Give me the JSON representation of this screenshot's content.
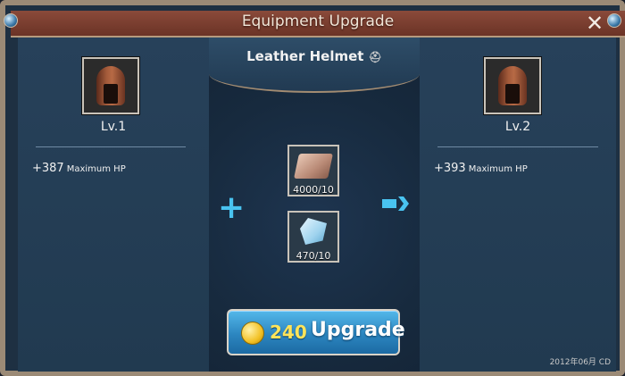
{
  "window": {
    "title": "Equipment Upgrade",
    "close_icon": "close-icon"
  },
  "item": {
    "name": "Leather Helmet",
    "name_icon": "helmet-small-icon"
  },
  "current": {
    "level": "Lv.1",
    "stat_value": "+387",
    "stat_name": "Maximum HP",
    "icon": "leather-helmet-icon"
  },
  "next": {
    "level": "Lv.2",
    "stat_value": "+393",
    "stat_name": "Maximum HP",
    "icon": "leather-helmet-icon"
  },
  "materials": [
    {
      "icon": "copper-ingot-icon",
      "qty": "4000/10"
    },
    {
      "icon": "crystal-shard-icon",
      "qty": "470/10"
    }
  ],
  "plus_icon": "plus-icon",
  "arrow_icon": "arrow-right-icon",
  "upgrade": {
    "coin_icon": "gold-coin-icon",
    "cost": "240",
    "label": "Upgrade"
  },
  "watermark": "2012年06月 CD",
  "colors": {
    "accent": "#49c3f0",
    "button": "#2c86c0",
    "cost": "#ffe45a",
    "titlebar": "#7a3e30"
  }
}
